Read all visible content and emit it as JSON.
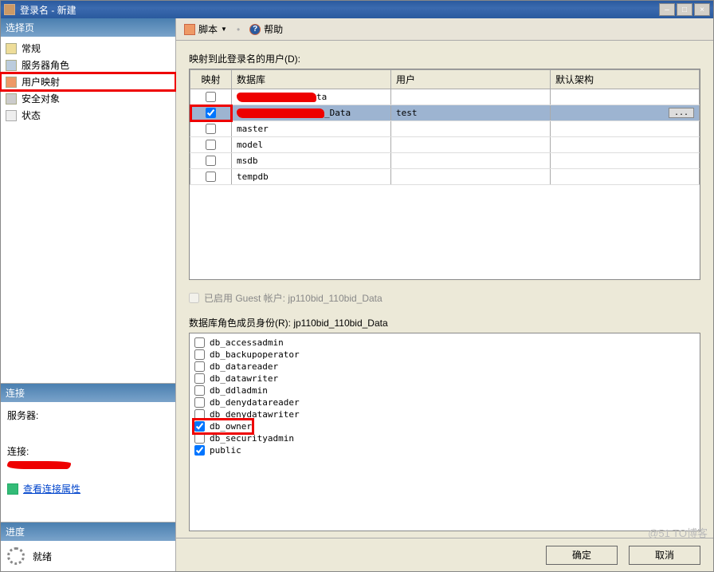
{
  "window": {
    "title": "登录名 - 新建",
    "min": "–",
    "max": "□",
    "close": "×"
  },
  "left": {
    "select_page_header": "选择页",
    "nav": [
      {
        "label": "常规",
        "iconClass": "key"
      },
      {
        "label": "服务器角色",
        "iconClass": "server"
      },
      {
        "label": "用户映射",
        "iconClass": "star",
        "highlight": true
      },
      {
        "label": "安全对象",
        "iconClass": "lock"
      },
      {
        "label": "状态",
        "iconClass": "doc"
      }
    ],
    "connection_header": "连接",
    "server_label": "服务器:",
    "conn_label": "连接:",
    "view_props": "查看连接属性",
    "progress_header": "进度",
    "progress_status": "就绪"
  },
  "toolbar": {
    "script": "脚本",
    "help": "帮助"
  },
  "main": {
    "mapped_users_label": "映射到此登录名的用户(D):",
    "columns": {
      "map": "映射",
      "database": "数据库",
      "user": "用户",
      "default_schema": "默认架构"
    },
    "rows": [
      {
        "checked": false,
        "db_suffix": "ta",
        "user": "",
        "redacted": true
      },
      {
        "checked": true,
        "db_suffix": "_Data",
        "user": "test",
        "redacted": true,
        "selected": true,
        "browse": "..."
      },
      {
        "checked": false,
        "db": "master",
        "user": ""
      },
      {
        "checked": false,
        "db": "model",
        "user": ""
      },
      {
        "checked": false,
        "db": "msdb",
        "user": ""
      },
      {
        "checked": false,
        "db": "tempdb",
        "user": ""
      }
    ],
    "guest_label": "已启用 Guest 帐户: jp110bid_110bid_Data",
    "roles_label": "数据库角色成员身份(R): jp110bid_110bid_Data",
    "roles": [
      {
        "name": "db_accessadmin",
        "checked": false
      },
      {
        "name": "db_backupoperator",
        "checked": false
      },
      {
        "name": "db_datareader",
        "checked": false
      },
      {
        "name": "db_datawriter",
        "checked": false
      },
      {
        "name": "db_ddladmin",
        "checked": false
      },
      {
        "name": "db_denydatareader",
        "checked": false
      },
      {
        "name": "db_denydatawriter",
        "checked": false
      },
      {
        "name": "db_owner",
        "checked": true,
        "boxed": true
      },
      {
        "name": "db_securityadmin",
        "checked": false
      },
      {
        "name": "public",
        "checked": true
      }
    ]
  },
  "buttons": {
    "ok": "确定",
    "cancel": "取消"
  },
  "watermark": "@51 TO博客"
}
